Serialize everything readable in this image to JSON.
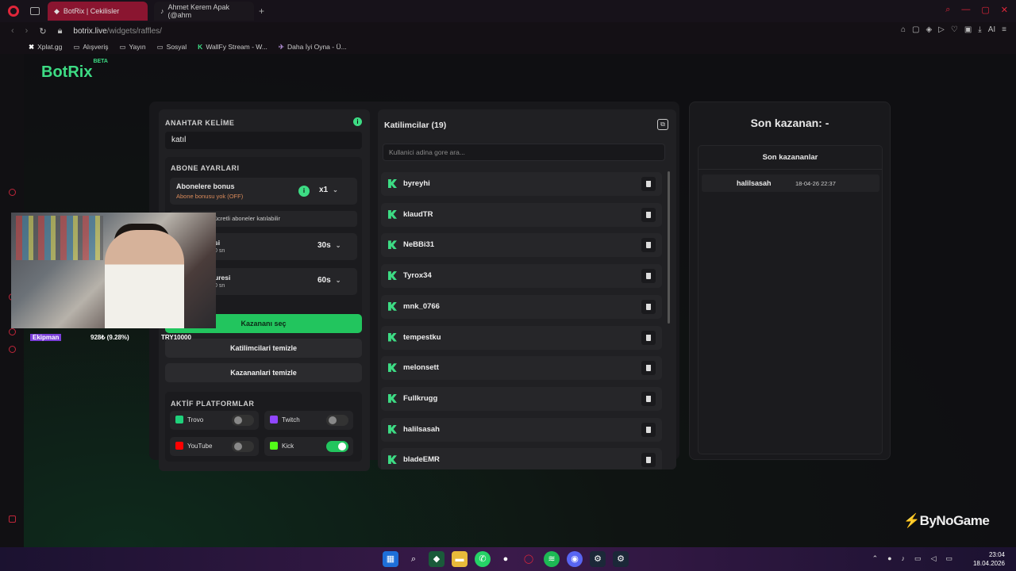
{
  "browser": {
    "tabs": [
      {
        "label": "BotRix | Cekilisler",
        "icon": "botrix-tab-icon"
      },
      {
        "label": "Ahmet Kerem Apak (@ahm",
        "icon": "tiktok-tab-icon"
      }
    ],
    "new_tab": "+",
    "url_host": "botrix.live",
    "url_path": "/widgets/raffles/",
    "bookmarks": [
      "Xplat.gg",
      "Alışveriş",
      "Yayın",
      "Sosyal",
      "WallFy Stream - W...",
      "Daha İyi Oyna - Ü..."
    ],
    "ai_label": "AI"
  },
  "app": {
    "logo": "BotRix",
    "logo_badge": "BETA",
    "accent": "#3ddc84"
  },
  "settings": {
    "keyword_label": "ANAHTAR KELİME",
    "keyword_value": "katıl",
    "sub_section": "ABONE AYARLARI",
    "bonus_title": "Abonelere bonus",
    "bonus_sub": "Abone bonusu yok (OFF)",
    "bonus_value": "x1",
    "paid_text": "ücretli aboneler katılabilir",
    "time1_title": "si",
    "time1_sub": "0 sn",
    "time1_value": "30s",
    "time2_title": "uresi",
    "time2_sub": "0 sn",
    "time2_value": "60s",
    "btn_pick": "Kazananı seç",
    "btn_clear_participants": "Katilimcilari temizle",
    "btn_clear_winners": "Kazananlari temizle",
    "platforms_label": "AKTİF PLATFORMLAR",
    "platforms": [
      {
        "name": "Trovo",
        "on": false,
        "color": "#1fd17b"
      },
      {
        "name": "Twitch",
        "on": false,
        "color": "#9146ff"
      },
      {
        "name": "YouTube",
        "on": false,
        "color": "#ff0000"
      },
      {
        "name": "Kick",
        "on": true,
        "color": "#53fc18"
      }
    ]
  },
  "stream_overlay": {
    "label": "Ekipman",
    "stat": "928₺ (9.28%)",
    "goal": "TRY10000"
  },
  "participants": {
    "title": "Katilimcilar (19)",
    "search_placeholder": "Kullanici adina gore ara...",
    "list": [
      "byreyhi",
      "klaudTR",
      "NeBBi31",
      "Tyrox34",
      "mnk_0766",
      "tempestku",
      "melonsett",
      "Fullkrugg",
      "halilsasah",
      "bladeEMR"
    ]
  },
  "winner": {
    "title": "Son kazanan: -",
    "list_title": "Son kazananlar",
    "rows": [
      {
        "name": "halilsasah",
        "time": "18-04-26 22:37"
      }
    ]
  },
  "watermark": "ByNoGame",
  "taskbar": {
    "time": "23:04",
    "date": "18.04.2026"
  }
}
